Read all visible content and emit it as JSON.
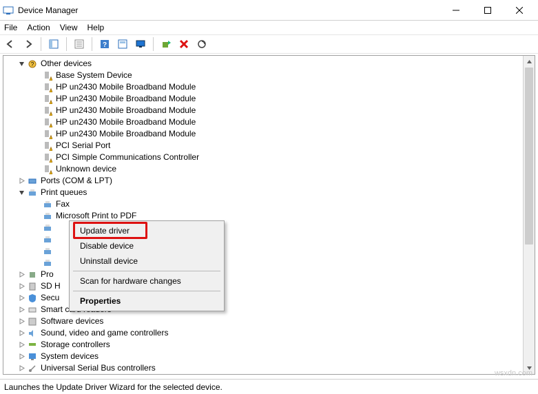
{
  "window": {
    "title": "Device Manager"
  },
  "menubar": [
    "File",
    "Action",
    "View",
    "Help"
  ],
  "toolbar": {
    "back": "back-arrow",
    "forward": "forward-arrow",
    "show_hidden": "show-hidden",
    "properties": "properties",
    "help": "help",
    "action_center": "action-center",
    "monitor": "monitor",
    "update": "update-driver",
    "uninstall": "uninstall",
    "scan": "scan-hardware"
  },
  "tree": {
    "other_devices": {
      "label": "Other devices",
      "expanded": true,
      "items": [
        "Base System Device",
        "HP un2430 Mobile Broadband Module",
        "HP un2430 Mobile Broadband Module",
        "HP un2430 Mobile Broadband Module",
        "HP un2430 Mobile Broadband Module",
        "HP un2430 Mobile Broadband Module",
        "PCI Serial Port",
        "PCI Simple Communications Controller",
        "Unknown device"
      ]
    },
    "ports": {
      "label": "Ports (COM & LPT)",
      "expanded": false
    },
    "print_queues": {
      "label": "Print queues",
      "expanded": true,
      "items": [
        "Fax",
        "Microsoft Print to PDF",
        "",
        "",
        "",
        ""
      ]
    },
    "processors": {
      "label": "Pro",
      "expanded": false
    },
    "sd_host": {
      "label": "SD H",
      "expanded": false
    },
    "security": {
      "label": "Secu",
      "expanded": false
    },
    "smartcard": {
      "label": "Smart card readers",
      "expanded": false
    },
    "software": {
      "label": "Software devices",
      "expanded": false
    },
    "sound": {
      "label": "Sound, video and game controllers",
      "expanded": false
    },
    "storage": {
      "label": "Storage controllers",
      "expanded": false
    },
    "system": {
      "label": "System devices",
      "expanded": false
    },
    "usb": {
      "label": "Universal Serial Bus controllers",
      "expanded": false
    }
  },
  "context_menu": {
    "update": "Update driver",
    "disable": "Disable device",
    "uninstall": "Uninstall device",
    "scan": "Scan for hardware changes",
    "properties": "Properties"
  },
  "statusbar": "Launches the Update Driver Wizard for the selected device.",
  "watermark": "wsxdn.com"
}
